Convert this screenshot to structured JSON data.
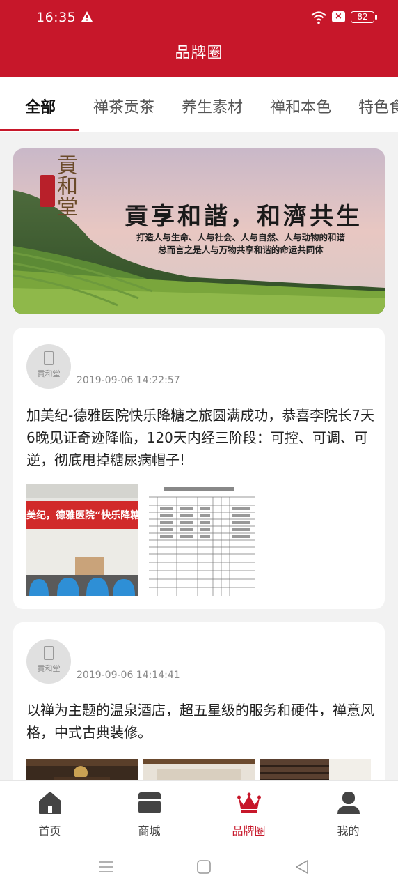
{
  "status": {
    "time": "16:35",
    "battery": "82"
  },
  "header": {
    "title": "品牌圈"
  },
  "tabs": [
    {
      "label": "全部"
    },
    {
      "label": "禅茶贡茶"
    },
    {
      "label": "养生素材"
    },
    {
      "label": "禅和本色"
    },
    {
      "label": "特色食"
    }
  ],
  "banner": {
    "logo_text": "貢和堂",
    "slogan": "貢享和諧，和濟共生",
    "line1": "打造人与生命、人与社会、人与自然、人与动物的和谐",
    "line2": "总而言之是人与万物共享和谐的命运共同体"
  },
  "posts": [
    {
      "avatar_text": "貢和堂",
      "time": "2019-09-06 14:22:57",
      "text": "加美纪-德雅医院快乐降糖之旅圆满成功，恭喜李院长7天6晚见证奇迹降临，120天内经三阶段：可控、可调、可逆，彻底甩掉糖尿病帽子!",
      "banner_text": "美纪，德雅医院“快乐降糖”体"
    },
    {
      "avatar_text": "貢和堂",
      "time": "2019-09-06 14:14:41",
      "text": "以禅为主题的温泉酒店，超五星级的服务和硬件，禅意风格，中式古典装修。"
    }
  ],
  "bottom_nav": [
    {
      "label": "首页",
      "icon": "home-icon"
    },
    {
      "label": "商城",
      "icon": "shop-icon"
    },
    {
      "label": "品牌圈",
      "icon": "crown-icon"
    },
    {
      "label": "我的",
      "icon": "user-icon"
    }
  ],
  "colors": {
    "brand": "#c7172a",
    "active_tab_text": "#111111"
  }
}
